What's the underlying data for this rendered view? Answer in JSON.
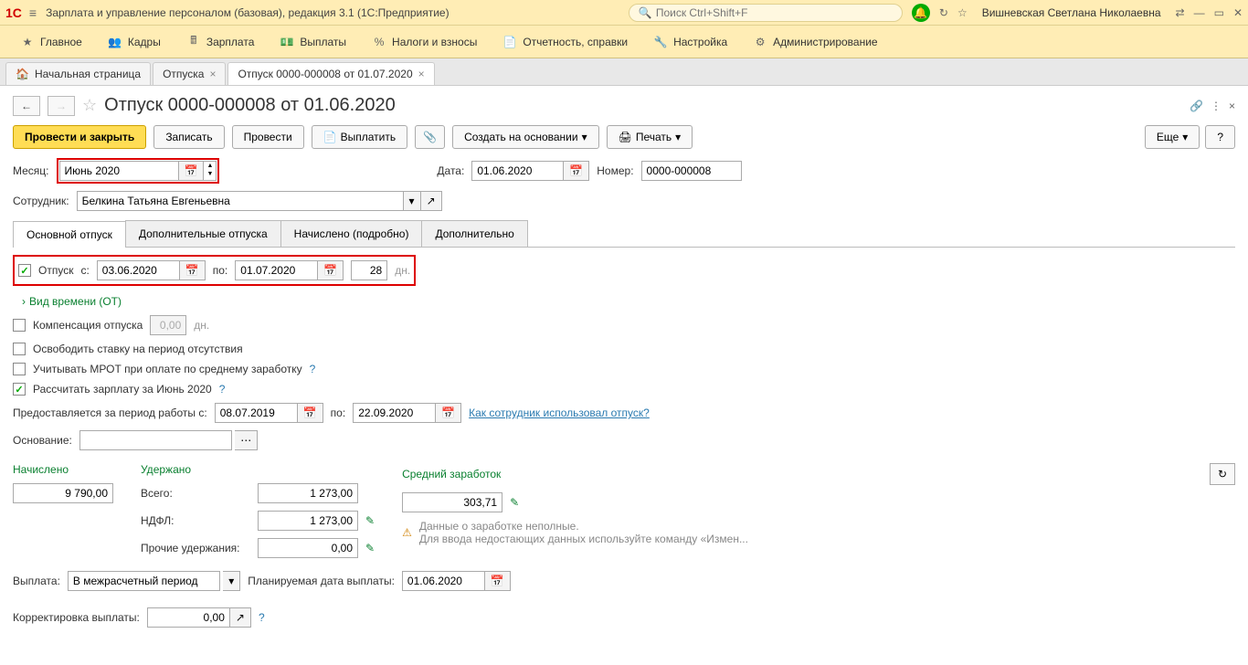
{
  "title": "Зарплата и управление персоналом (базовая), редакция 3.1  (1С:Предприятие)",
  "search_placeholder": "Поиск Ctrl+Shift+F",
  "user": "Вишневская Светлана Николаевна",
  "mainmenu": [
    "Главное",
    "Кадры",
    "Зарплата",
    "Выплаты",
    "Налоги и взносы",
    "Отчетность, справки",
    "Настройка",
    "Администрирование"
  ],
  "tabs": {
    "home": "Начальная страница",
    "t1": "Отпуска",
    "t2": "Отпуск 0000-000008 от 01.07.2020"
  },
  "doc_title": "Отпуск 0000-000008 от 01.06.2020",
  "toolbar": {
    "post_close": "Провести и закрыть",
    "write": "Записать",
    "post": "Провести",
    "pay": "Выплатить",
    "create_based": "Создать на основании",
    "print": "Печать",
    "more": "Еще",
    "help": "?"
  },
  "month": {
    "label": "Месяц:",
    "value": "Июнь 2020"
  },
  "date": {
    "label": "Дата:",
    "value": "01.06.2020"
  },
  "number": {
    "label": "Номер:",
    "value": "0000-000008"
  },
  "employee": {
    "label": "Сотрудник:",
    "value": "Белкина Татьяна Евгеньевна"
  },
  "doctabs": [
    "Основной отпуск",
    "Дополнительные отпуска",
    "Начислено (подробно)",
    "Дополнительно"
  ],
  "vacation": {
    "label": "Отпуск",
    "from_label": "с:",
    "from": "03.06.2020",
    "to_label": "по:",
    "to": "01.07.2020",
    "days": "28",
    "dn": "дн."
  },
  "time_type": "Вид времени (ОТ)",
  "compensation": {
    "label": "Компенсация отпуска",
    "value": "0,00",
    "dn": "дн."
  },
  "release_position": "Освободить ставку на период отсутствия",
  "mrot": "Учитывать МРОТ при оплате по среднему заработку",
  "calc_salary": "Рассчитать зарплату за Июнь 2020",
  "work_period": {
    "label": "Предоставляется за период работы с:",
    "from": "08.07.2019",
    "to_label": "по:",
    "to": "22.09.2020",
    "link": "Как сотрудник использовал отпуск?"
  },
  "basis_label": "Основание:",
  "totals": {
    "accrued": {
      "head": "Начислено",
      "value": "9 790,00"
    },
    "deducted": {
      "head": "Удержано",
      "total_label": "Всего:",
      "total": "1 273,00",
      "ndfl_label": "НДФЛ:",
      "ndfl": "1 273,00",
      "other_label": "Прочие удержания:",
      "other": "0,00"
    },
    "avg_earn": {
      "head": "Средний заработок",
      "value": "303,71",
      "warn1": "Данные о заработке неполные.",
      "warn2": "Для ввода недостающих данных используйте команду «Измен..."
    }
  },
  "payout": {
    "label": "Выплата:",
    "value": "В межрасчетный период",
    "planned_label": "Планируемая дата выплаты:",
    "planned": "01.06.2020"
  },
  "correction": {
    "label": "Корректировка выплаты:",
    "value": "0,00"
  }
}
